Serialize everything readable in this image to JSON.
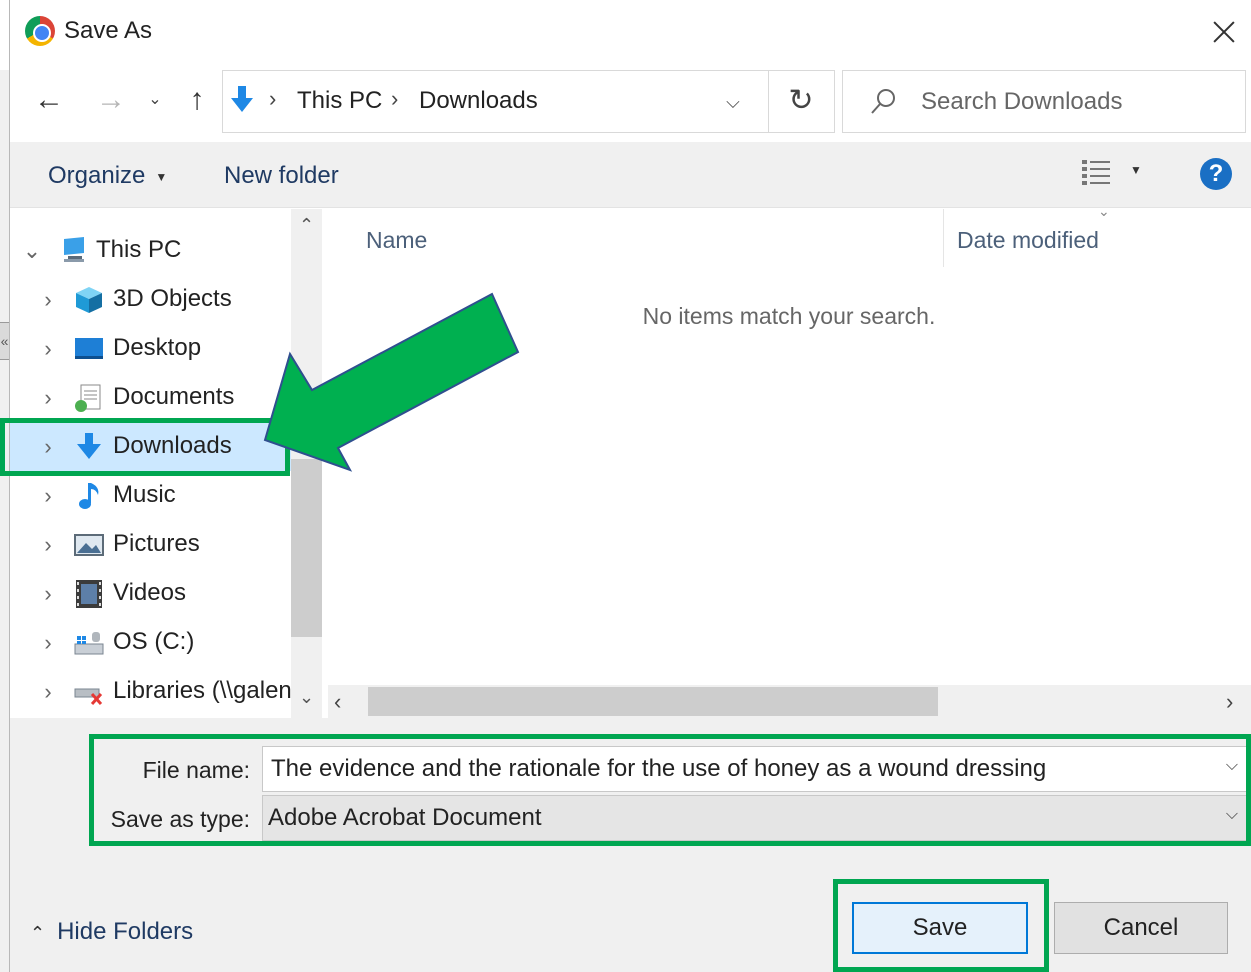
{
  "window": {
    "title": "Save As"
  },
  "nav": {
    "breadcrumbs": [
      "This PC",
      "Downloads"
    ],
    "search_placeholder": "Search Downloads"
  },
  "toolbar": {
    "organize": "Organize",
    "new_folder": "New folder"
  },
  "tree": [
    {
      "label": "This PC",
      "icon": "this-pc-icon",
      "expanded": true
    },
    {
      "label": "3D Objects",
      "icon": "3d-objects-icon"
    },
    {
      "label": "Desktop",
      "icon": "desktop-icon"
    },
    {
      "label": "Documents",
      "icon": "documents-icon"
    },
    {
      "label": "Downloads",
      "icon": "downloads-icon",
      "selected": true
    },
    {
      "label": "Music",
      "icon": "music-icon"
    },
    {
      "label": "Pictures",
      "icon": "pictures-icon"
    },
    {
      "label": "Videos",
      "icon": "videos-icon"
    },
    {
      "label": "OS (C:)",
      "icon": "drive-icon"
    },
    {
      "label": "Libraries (\\\\galen",
      "icon": "network-drive-icon"
    }
  ],
  "content": {
    "columns": [
      "Name",
      "Date modified"
    ],
    "empty_message": "No items match your search."
  },
  "form": {
    "file_name_label": "File name:",
    "file_name_value": "The evidence and the rationale for the use of honey as a wound dressing",
    "save_type_label": "Save as type:",
    "save_type_value": "Adobe Acrobat Document"
  },
  "footer": {
    "hide_folders": "Hide Folders",
    "save": "Save",
    "cancel": "Cancel"
  },
  "colors": {
    "annotation": "#00a651",
    "selection": "#cce8ff",
    "accent": "#0078d7"
  }
}
